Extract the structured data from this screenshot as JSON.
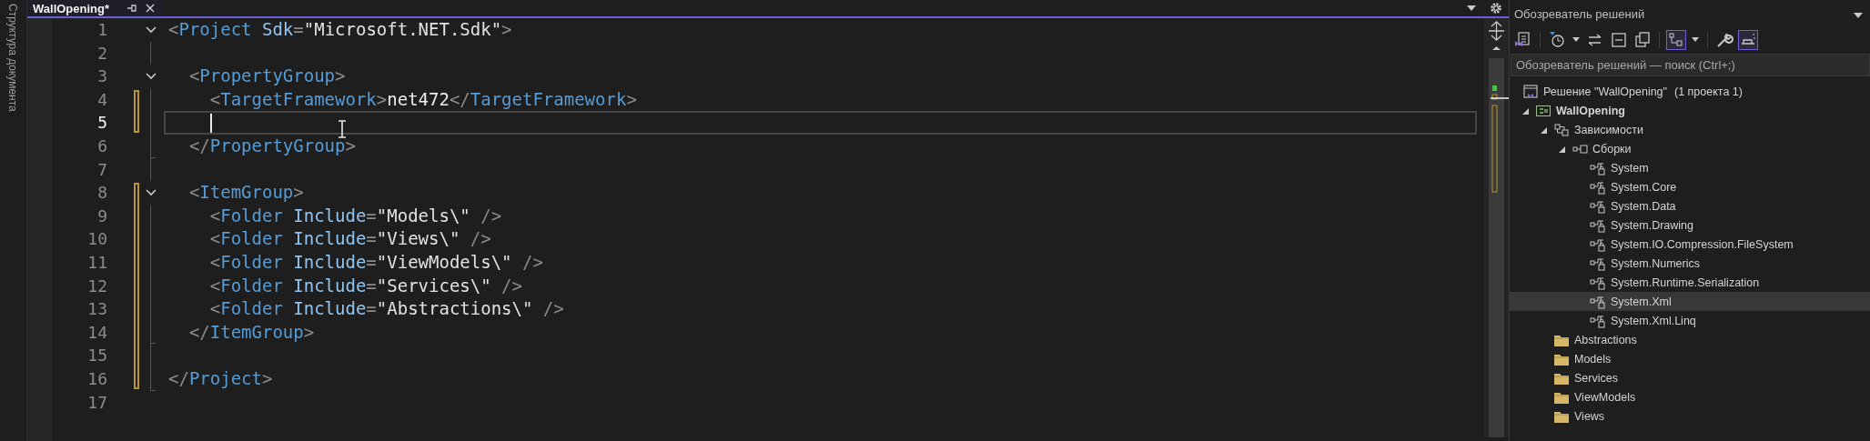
{
  "side_panel": {
    "label": "Структура документа"
  },
  "editor": {
    "tabs": [
      {
        "title": "WallOpening*",
        "selected": true
      }
    ],
    "lines": [
      {
        "number": "1",
        "expanded": true,
        "changed": false,
        "current": false,
        "code": [
          {
            "kind": "punct",
            "text": "<"
          },
          {
            "kind": "tag",
            "text": "Project"
          },
          {
            "kind": "attr",
            "text": " Sdk"
          },
          {
            "kind": "punct",
            "text": "="
          },
          {
            "kind": "value",
            "text": "\"Microsoft.NET.Sdk\""
          },
          {
            "kind": "punct",
            "text": ">"
          }
        ]
      },
      {
        "number": "2",
        "changed": false,
        "current": false
      },
      {
        "number": "3",
        "expanded": true,
        "changed": false,
        "current": false,
        "code": [
          {
            "kind": "punct",
            "text": "  <"
          },
          {
            "kind": "tag",
            "text": "PropertyGroup"
          },
          {
            "kind": "punct",
            "text": ">"
          }
        ]
      },
      {
        "number": "4",
        "changed": true,
        "current": false,
        "code": [
          {
            "kind": "punct",
            "text": "    <"
          },
          {
            "kind": "tag",
            "text": "TargetFramework"
          },
          {
            "kind": "punct",
            "text": ">"
          },
          {
            "kind": "text",
            "text": "net472"
          },
          {
            "kind": "punct",
            "text": "</"
          },
          {
            "kind": "tag",
            "text": "TargetFramework"
          },
          {
            "kind": "punct",
            "text": ">"
          }
        ]
      },
      {
        "number": "5",
        "changed": true,
        "current": true,
        "caret": true
      },
      {
        "number": "6",
        "block_end": true,
        "changed": false,
        "current": false,
        "code": [
          {
            "kind": "punct",
            "text": "  </"
          },
          {
            "kind": "tag",
            "text": "PropertyGroup"
          },
          {
            "kind": "punct",
            "text": ">"
          }
        ]
      },
      {
        "number": "7",
        "changed": false,
        "current": false
      },
      {
        "number": "8",
        "expanded": true,
        "changed": true,
        "current": false,
        "code": [
          {
            "kind": "punct",
            "text": "  <"
          },
          {
            "kind": "tag",
            "text": "ItemGroup"
          },
          {
            "kind": "punct",
            "text": ">"
          }
        ]
      },
      {
        "number": "9",
        "changed": true,
        "current": false,
        "code": [
          {
            "kind": "punct",
            "text": "    <"
          },
          {
            "kind": "tag",
            "text": "Folder"
          },
          {
            "kind": "attr",
            "text": " Include"
          },
          {
            "kind": "punct",
            "text": "="
          },
          {
            "kind": "value",
            "text": "\"Models\\\""
          },
          {
            "kind": "punct",
            "text": " />"
          }
        ]
      },
      {
        "number": "10",
        "changed": true,
        "current": false,
        "code": [
          {
            "kind": "punct",
            "text": "    <"
          },
          {
            "kind": "tag",
            "text": "Folder"
          },
          {
            "kind": "attr",
            "text": " Include"
          },
          {
            "kind": "punct",
            "text": "="
          },
          {
            "kind": "value",
            "text": "\"Views\\\""
          },
          {
            "kind": "punct",
            "text": " />"
          }
        ]
      },
      {
        "number": "11",
        "changed": true,
        "current": false,
        "code": [
          {
            "kind": "punct",
            "text": "    <"
          },
          {
            "kind": "tag",
            "text": "Folder"
          },
          {
            "kind": "attr",
            "text": " Include"
          },
          {
            "kind": "punct",
            "text": "="
          },
          {
            "kind": "value",
            "text": "\"ViewModels\\\""
          },
          {
            "kind": "punct",
            "text": " />"
          }
        ]
      },
      {
        "number": "12",
        "changed": true,
        "current": false,
        "code": [
          {
            "kind": "punct",
            "text": "    <"
          },
          {
            "kind": "tag",
            "text": "Folder"
          },
          {
            "kind": "attr",
            "text": " Include"
          },
          {
            "kind": "punct",
            "text": "="
          },
          {
            "kind": "value",
            "text": "\"Services\\\""
          },
          {
            "kind": "punct",
            "text": " />"
          }
        ]
      },
      {
        "number": "13",
        "changed": true,
        "current": false,
        "code": [
          {
            "kind": "punct",
            "text": "    <"
          },
          {
            "kind": "tag",
            "text": "Folder"
          },
          {
            "kind": "attr",
            "text": " Include"
          },
          {
            "kind": "punct",
            "text": "="
          },
          {
            "kind": "value",
            "text": "\"Abstractions\\\""
          },
          {
            "kind": "punct",
            "text": " />"
          }
        ]
      },
      {
        "number": "14",
        "block_end": true,
        "changed": true,
        "current": false,
        "code": [
          {
            "kind": "punct",
            "text": "  </"
          },
          {
            "kind": "tag",
            "text": "ItemGroup"
          },
          {
            "kind": "punct",
            "text": ">"
          }
        ]
      },
      {
        "number": "15",
        "changed": true,
        "current": false
      },
      {
        "number": "16",
        "block_end": true,
        "changed": true,
        "current": false,
        "code": [
          {
            "kind": "punct",
            "text": "</"
          },
          {
            "kind": "tag",
            "text": "Project"
          },
          {
            "kind": "punct",
            "text": ">"
          }
        ]
      },
      {
        "number": "17",
        "changed": false,
        "current": false
      }
    ]
  },
  "solution_explorer": {
    "title": "Обозреватель решений",
    "toolbar": [
      {
        "kind": "home",
        "on": false
      },
      {
        "kind": "sep"
      },
      {
        "kind": "pending",
        "on": false
      },
      {
        "kind": "caret"
      },
      {
        "kind": "sync",
        "on": false
      },
      {
        "kind": "collapse",
        "on": false
      },
      {
        "kind": "copies",
        "on": false
      },
      {
        "kind": "sep"
      },
      {
        "kind": "tree",
        "on": true
      },
      {
        "kind": "caret"
      },
      {
        "kind": "sep"
      },
      {
        "kind": "wrench",
        "on": false
      },
      {
        "kind": "preview",
        "on": true
      }
    ],
    "search": {
      "placeholder": "Обозреватель решений — поиск (Ctrl+;)"
    },
    "tree": [
      {
        "kind": "solution",
        "label": "Решение \"WallOpening\"",
        "note": "(1 проекта 1)",
        "selected": false,
        "children": [
          {
            "kind": "project",
            "label": "WallOpening",
            "expanded": true,
            "selected": false,
            "children": [
              {
                "kind": "dependencies",
                "label": "Зависимости",
                "expanded": true,
                "selected": false,
                "children": [
                  {
                    "kind": "assemblies",
                    "label": "Сборки",
                    "expanded": true,
                    "selected": false,
                    "children": [
                      {
                        "kind": "reference",
                        "label": "System",
                        "selected": false
                      },
                      {
                        "kind": "reference",
                        "label": "System.Core",
                        "selected": false
                      },
                      {
                        "kind": "reference",
                        "label": "System.Data",
                        "selected": false
                      },
                      {
                        "kind": "reference",
                        "label": "System.Drawing",
                        "selected": false
                      },
                      {
                        "kind": "reference",
                        "label": "System.IO.Compression.FileSystem",
                        "selected": false
                      },
                      {
                        "kind": "reference",
                        "label": "System.Numerics",
                        "selected": false
                      },
                      {
                        "kind": "reference",
                        "label": "System.Runtime.Serialization",
                        "selected": false
                      },
                      {
                        "kind": "reference",
                        "label": "System.Xml",
                        "selected": true
                      },
                      {
                        "kind": "reference",
                        "label": "System.Xml.Linq",
                        "selected": false
                      }
                    ]
                  }
                ]
              },
              {
                "kind": "folder",
                "label": "Abstractions",
                "selected": false
              },
              {
                "kind": "folder",
                "label": "Models",
                "selected": false
              },
              {
                "kind": "folder",
                "label": "Services",
                "selected": false
              },
              {
                "kind": "folder",
                "label": "ViewModels",
                "selected": false
              },
              {
                "kind": "folder",
                "label": "Views",
                "selected": false
              }
            ]
          }
        ]
      }
    ]
  }
}
